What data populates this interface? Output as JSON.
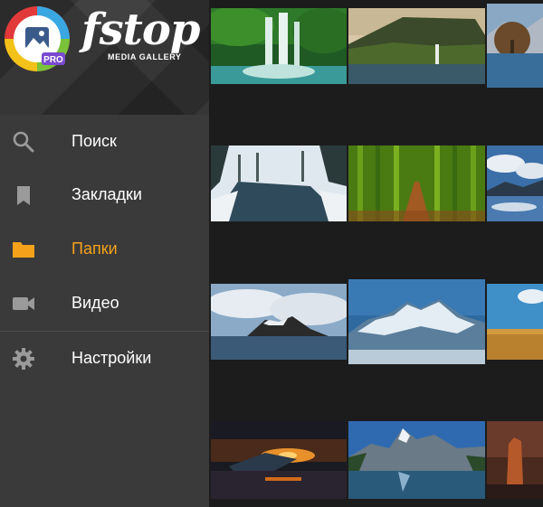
{
  "brand": {
    "name": "fstop",
    "subtitle": "MEDIA GALLERY",
    "badge": "PRO",
    "accent_color": "#f5a21a"
  },
  "menu": {
    "items": [
      {
        "label": "Поиск",
        "icon": "search-icon",
        "active": false
      },
      {
        "label": "Закладки",
        "icon": "bookmark-icon",
        "active": false
      },
      {
        "label": "Папки",
        "icon": "folder-icon",
        "active": true
      },
      {
        "label": "Видео",
        "icon": "video-camera-icon",
        "active": false
      },
      {
        "label": "Настройки",
        "icon": "gear-icon",
        "active": false
      }
    ]
  },
  "gallery": {
    "thumbnails": [
      "waterfall-forest",
      "sea-cliff-waterfall",
      "lake-tree",
      "snowy-river",
      "bamboo-forest",
      "lake-clouds",
      "island-mountain",
      "snowy-peaks",
      "golden-field",
      "ocean-sunset",
      "mountain-lake-reflection",
      "red-rock-sunset"
    ]
  }
}
